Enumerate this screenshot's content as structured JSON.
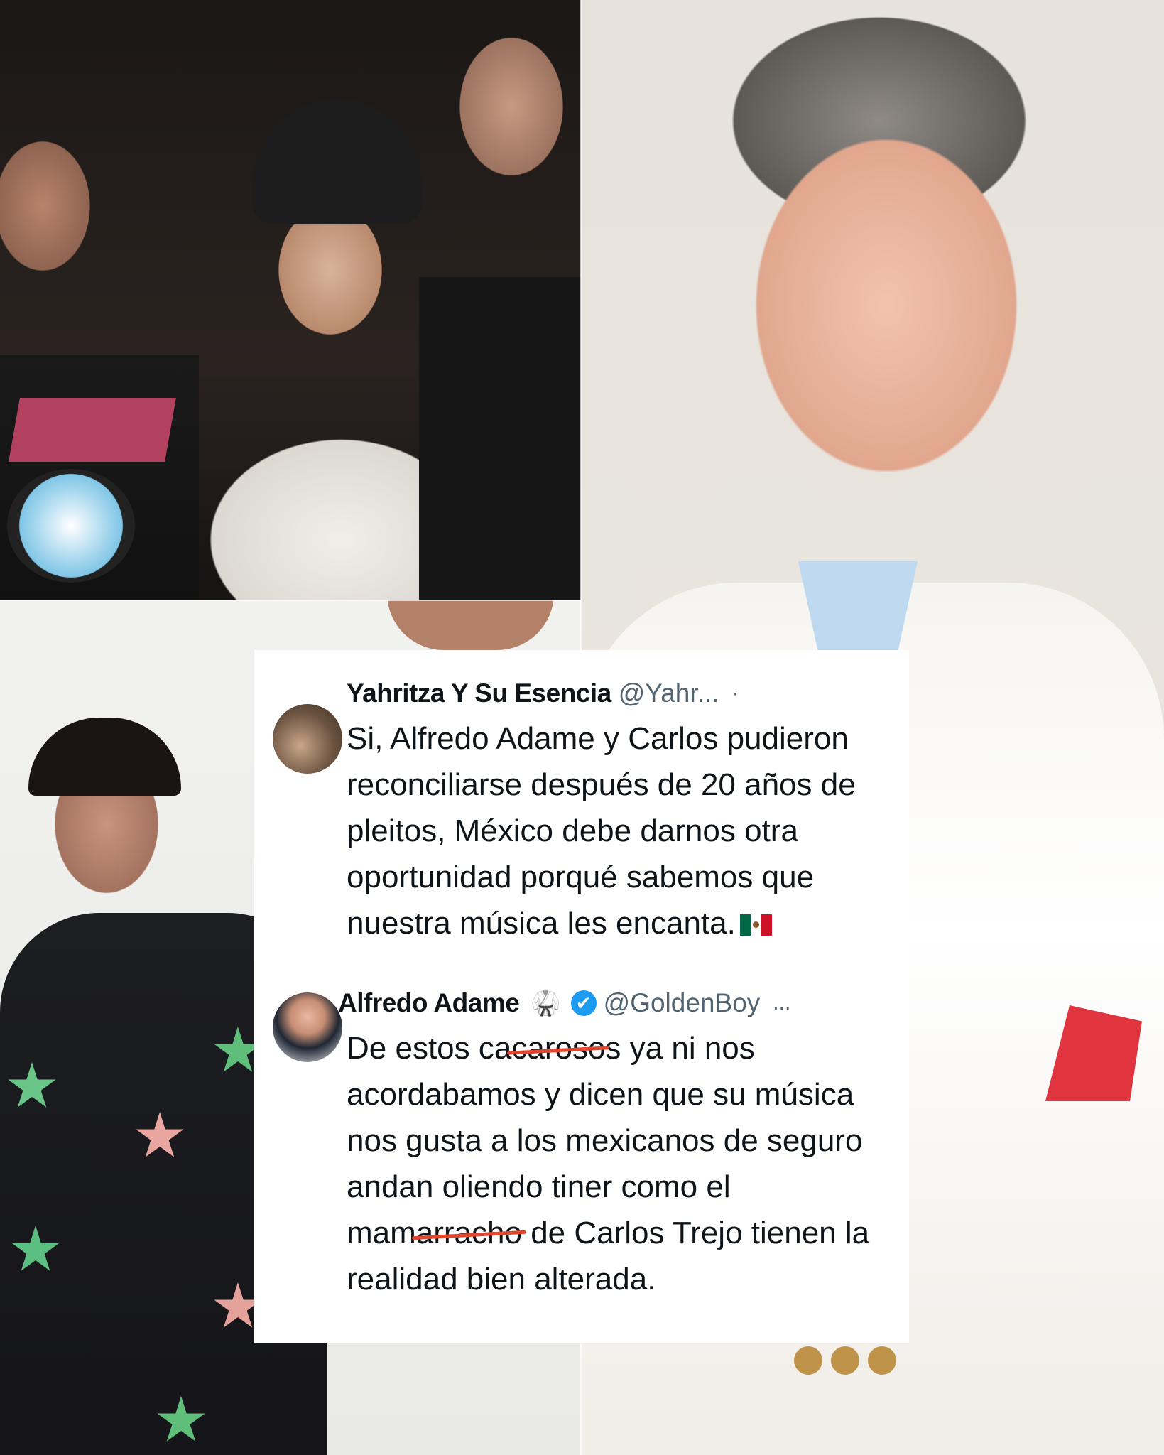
{
  "tweets": [
    {
      "name": "Yahritza Y Su Esencia",
      "handle": "@Yahr...",
      "more": "·",
      "lines": [
        "Si, Alfredo Adame y Carlos pudieron",
        "reconciliarse después de 20 años  de",
        "pleitos, México debe darnos otra",
        "oportunidad porqué sabemos que",
        "nuestra música les encanta."
      ]
    },
    {
      "name": "Alfredo Adame",
      "name_icon": "🥋",
      "handle": "@GoldenBoy",
      "more": "...",
      "verified_glyph": "✔",
      "lines": [
        "De estos ca",
        "caroso",
        "s ya ni nos",
        "acordabamos y dicen que su música",
        "nos gusta a los mexicanos de seguro",
        "andan oliendo tiner como el",
        "mam",
        "arracho",
        " de Carlos Trejo tienen la",
        "realidad bien alterada."
      ]
    }
  ],
  "colors": {
    "name": "#0f1419",
    "handle": "#536471",
    "verified": "#1d9bf0",
    "strike": "#e2452d"
  },
  "icons": [
    "mexico-flag-icon",
    "verified-badge-icon",
    "martial-arts-uniform-icon",
    "more-icon"
  ]
}
